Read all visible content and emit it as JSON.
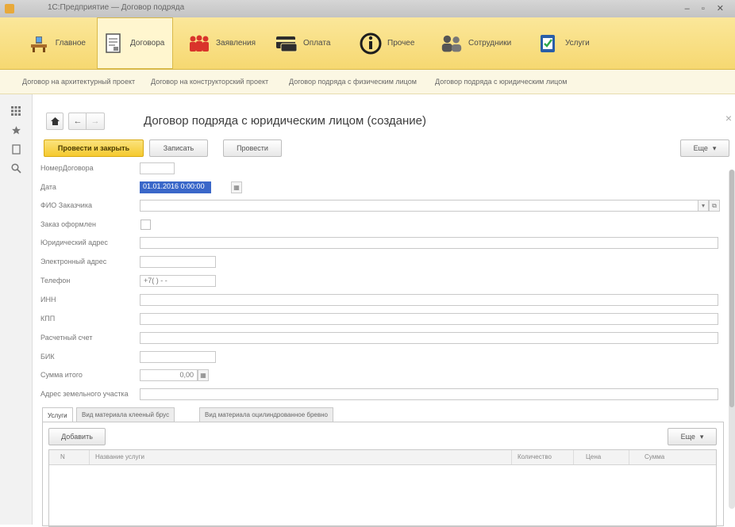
{
  "window": {
    "title": "1С:Предприятие — Договор подряда",
    "controls": "–  ▫  ✕"
  },
  "sections": [
    {
      "label": "Главное",
      "icon": "home-desk-icon"
    },
    {
      "label": "Договора",
      "icon": "document-icon"
    },
    {
      "label": "Заявления",
      "icon": "people-icon"
    },
    {
      "label": "Оплата",
      "icon": "payment-card-icon"
    },
    {
      "label": "Прочее",
      "icon": "info-icon"
    },
    {
      "label": "Сотрудники",
      "icon": "employees-icon"
    },
    {
      "label": "Услуги",
      "icon": "services-checklist-icon"
    }
  ],
  "subnav": [
    "Договор на архитектурный проект",
    "Договор на конструкторский проект",
    "Договор подряда с физическим лицом",
    "Договор подряда с юридическим лицом"
  ],
  "form": {
    "title": "Договор подряда с юридическим лицом (создание)",
    "buttons": {
      "post_close": "Провести и закрыть",
      "save": "Записать",
      "post": "Провести",
      "more": "Еще"
    },
    "fields": {
      "contract_number_label": "НомерДоговора",
      "date_label": "Дата",
      "date_value": "01.01.2016 0:00:00",
      "customer_label": "ФИО Заказчика",
      "issued_label": "Заказ оформлен",
      "legal_address_label": "Юридический адрес",
      "email_label": "Электронный адрес",
      "phone_label": "Телефон",
      "phone_value": "+7(   )   -  -  ",
      "inn_label": "ИНН",
      "kpp_label": "КПП",
      "account_label": "Расчетный счет",
      "bik_label": "БИК",
      "total_label": "Сумма итого",
      "total_value": "0,00",
      "land_address_label": "Адрес земельного участка"
    },
    "tabs": [
      "Услуги",
      "Вид материала клееный брус",
      "Вид материала оцилиндрованное бревно"
    ],
    "services": {
      "add": "Добавить",
      "more": "Еще",
      "columns": [
        "N",
        "Название услуги",
        "Количество",
        "Цена",
        "Сумма"
      ]
    }
  }
}
